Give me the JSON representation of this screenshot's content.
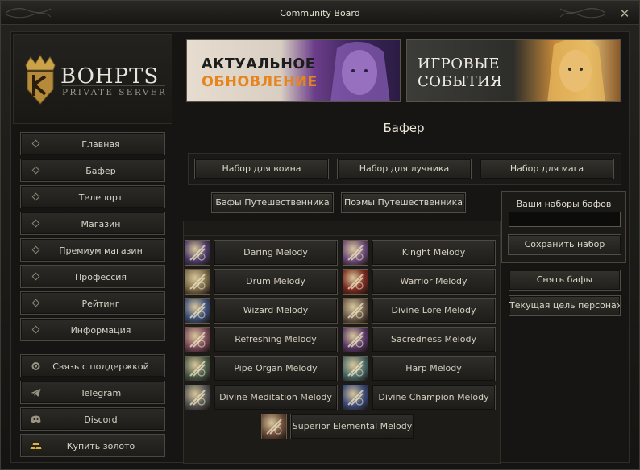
{
  "window": {
    "title": "Community Board"
  },
  "logo": {
    "name": "BOHPTS",
    "subtitle": "PRIVATE SERVER"
  },
  "nav": [
    {
      "label": "Главная"
    },
    {
      "label": "Бафер"
    },
    {
      "label": "Телепорт"
    },
    {
      "label": "Магазин"
    },
    {
      "label": "Премиум магазин"
    },
    {
      "label": "Профессия"
    },
    {
      "label": "Рейтинг"
    },
    {
      "label": "Информация"
    }
  ],
  "links": [
    {
      "label": "Связь с поддержкой",
      "icon": "support-gear-icon"
    },
    {
      "label": "Telegram",
      "icon": "telegram-icon"
    },
    {
      "label": "Discord",
      "icon": "discord-icon"
    },
    {
      "label": "Купить золото",
      "icon": "gold-bars-icon"
    }
  ],
  "banners": [
    {
      "line1": "АКТУАЛЬНОЕ",
      "line2": "ОБНОВЛЕНИЕ"
    },
    {
      "line1": "ИГРОВЫЕ",
      "line2": "СОБЫТИЯ"
    }
  ],
  "section": {
    "title": "Бафер"
  },
  "sets": [
    {
      "label": "Набор для воина"
    },
    {
      "label": "Набор для лучника"
    },
    {
      "label": "Набор для мага"
    }
  ],
  "tabs": [
    {
      "label": "Бафы Путешественника"
    },
    {
      "label": "Поэмы Путешественника"
    }
  ],
  "buffs": [
    {
      "name": "Daring Melody",
      "icon": "daring-melody-icon",
      "color": "#4a3b6a"
    },
    {
      "name": "Kinght Melody",
      "icon": "knight-melody-icon",
      "color": "#6b4a7a"
    },
    {
      "name": "Drum Melody",
      "icon": "drum-melody-icon",
      "color": "#7a6a4a"
    },
    {
      "name": "Warrior Melody",
      "icon": "warrior-melody-icon",
      "color": "#7a2a22"
    },
    {
      "name": "Wizard Melody",
      "icon": "wizard-melody-icon",
      "color": "#3b4f7a"
    },
    {
      "name": "Divine Lore Melody",
      "icon": "divine-lore-melody-icon",
      "color": "#6a5a4a"
    },
    {
      "name": "Refreshing Melody",
      "icon": "refreshing-melody-icon",
      "color": "#7a4a5a"
    },
    {
      "name": "Sacredness Melody",
      "icon": "sacredness-melody-icon",
      "color": "#5a3a6a"
    },
    {
      "name": "Pipe Organ Melody",
      "icon": "pipe-organ-melody-icon",
      "color": "#4a5a4a"
    },
    {
      "name": "Harp Melody",
      "icon": "harp-melody-icon",
      "color": "#4a6a6a"
    },
    {
      "name": "Divine Meditation Melody",
      "icon": "divine-meditation-melody-icon",
      "color": "#555555"
    },
    {
      "name": "Divine Champion Melody",
      "icon": "divine-champion-melody-icon",
      "color": "#3a4a7a"
    },
    {
      "name": "Superior Elemental Melody",
      "icon": "superior-elemental-melody-icon",
      "color": "#6a4a3a"
    }
  ],
  "saves": {
    "label": "Ваши наборы бафов",
    "input_value": "",
    "save_button": "Сохранить набор"
  },
  "actions": {
    "remove_buffs": "Снять бафы",
    "current_target": "Текущая цель персонаж"
  }
}
